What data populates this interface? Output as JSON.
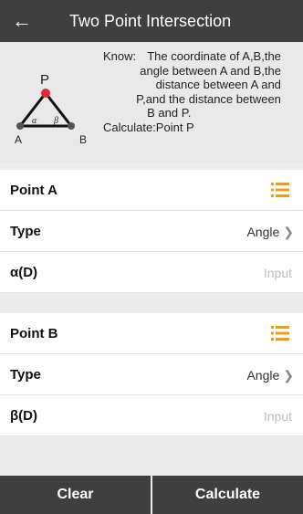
{
  "header": {
    "title": "Two Point Intersection",
    "back_icon": "arrow-left-icon",
    "background": "#3f3f3f"
  },
  "info": {
    "diagram": {
      "vertex_top": "P",
      "vertex_left": "A",
      "vertex_right": "B",
      "angle_left": "α",
      "angle_right": "β",
      "point_color": "#e8253f"
    },
    "know_label": "Know:",
    "know_lines": [
      "The coordinate of A,B,the",
      "angle between A and B,the",
      "distance between A and",
      "P,and the distance between",
      "B and P."
    ],
    "calculate": "Calculate:Point P"
  },
  "point_a": {
    "label": "Point A",
    "icon": "list-icon",
    "type_label": "Type",
    "type_value": "Angle",
    "angle_label": "α(D)",
    "angle_placeholder": "Input"
  },
  "point_b": {
    "label": "Point B",
    "icon": "list-icon",
    "type_label": "Type",
    "type_value": "Angle",
    "angle_label": "β(D)",
    "angle_placeholder": "Input"
  },
  "buttons": {
    "clear": "Clear",
    "calculate": "Calculate"
  },
  "colors": {
    "accent": "#f39c12",
    "button_bg": "#3f3f3f"
  }
}
